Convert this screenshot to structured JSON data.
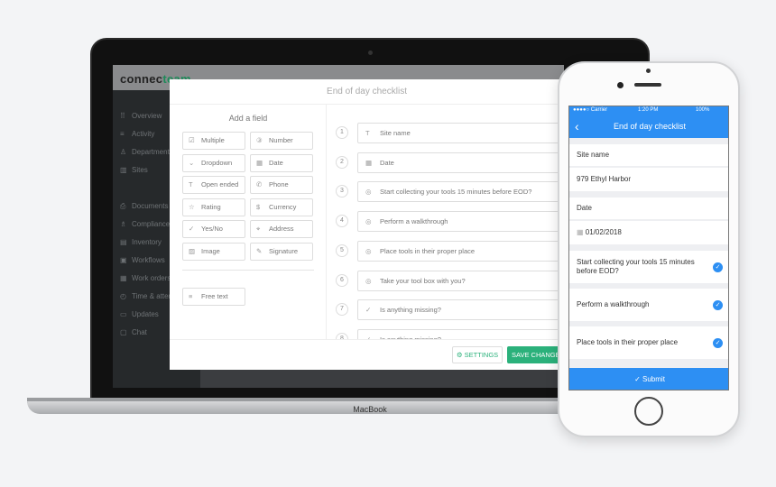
{
  "laptop": {
    "brand": "MacBook"
  },
  "app": {
    "logo_a": "connec",
    "logo_b": "team",
    "accent": "#2bb17b"
  },
  "sidebar": {
    "items": [
      {
        "icon": "grid-icon",
        "glyph": "⠿",
        "label": "Overview"
      },
      {
        "icon": "list-icon",
        "glyph": "≡",
        "label": "Activity"
      },
      {
        "icon": "user-icon",
        "glyph": "♙",
        "label": "Departments"
      },
      {
        "icon": "building-icon",
        "glyph": "▥",
        "label": "Sites"
      },
      {
        "icon": "document-icon",
        "glyph": "⎙",
        "label": "Documents"
      },
      {
        "icon": "compliance-icon",
        "glyph": "♗",
        "label": "Compliance"
      },
      {
        "icon": "inventory-icon",
        "glyph": "▤",
        "label": "Inventory"
      },
      {
        "icon": "workflow-icon",
        "glyph": "▣",
        "label": "Workflows"
      },
      {
        "icon": "work-order-icon",
        "glyph": "▦",
        "label": "Work orders"
      },
      {
        "icon": "clock-icon",
        "glyph": "◴",
        "label": "Time & attendance"
      },
      {
        "icon": "updates-icon",
        "glyph": "▭",
        "label": "Updates"
      },
      {
        "icon": "chat-icon",
        "glyph": "▢",
        "label": "Chat"
      }
    ]
  },
  "modal": {
    "title": "End of day checklist",
    "add_field_title": "Add a field",
    "fields": [
      {
        "icon": "checkbox-icon",
        "glyph": "☑",
        "label": "Multiple"
      },
      {
        "icon": "number-icon",
        "glyph": "③",
        "label": "Number"
      },
      {
        "icon": "chevron-down-icon",
        "glyph": "⌄",
        "label": "Dropdown"
      },
      {
        "icon": "calendar-icon",
        "glyph": "▦",
        "label": "Date"
      },
      {
        "icon": "text-icon",
        "glyph": "T",
        "label": "Open ended"
      },
      {
        "icon": "phone-icon",
        "glyph": "✆",
        "label": "Phone"
      },
      {
        "icon": "star-icon",
        "glyph": "☆",
        "label": "Rating"
      },
      {
        "icon": "currency-icon",
        "glyph": "$",
        "label": "Currency"
      },
      {
        "icon": "check-icon",
        "glyph": "✓",
        "label": "Yes/No"
      },
      {
        "icon": "location-icon",
        "glyph": "⌖",
        "label": "Address"
      },
      {
        "icon": "image-icon",
        "glyph": "▨",
        "label": "Image"
      },
      {
        "icon": "pen-icon",
        "glyph": "✎",
        "label": "Signature"
      }
    ],
    "free_text": {
      "icon": "paragraph-icon",
      "glyph": "≡",
      "label": "Free text"
    },
    "checklist": [
      {
        "n": "1",
        "icon": "text-icon",
        "glyph": "T",
        "label": "Site name"
      },
      {
        "n": "2",
        "icon": "calendar-icon",
        "glyph": "▦",
        "label": "Date"
      },
      {
        "n": "3",
        "icon": "check-circle-icon",
        "glyph": "◎",
        "label": "Start collecting your tools 15 minutes before EOD?"
      },
      {
        "n": "4",
        "icon": "check-circle-icon",
        "glyph": "◎",
        "label": "Perform a walkthrough"
      },
      {
        "n": "5",
        "icon": "check-circle-icon",
        "glyph": "◎",
        "label": "Place tools in their proper place"
      },
      {
        "n": "6",
        "icon": "check-circle-icon",
        "glyph": "◎",
        "label": "Take your tool box with you?"
      },
      {
        "n": "7",
        "icon": "check-icon",
        "glyph": "✓",
        "label": "Is anything missing?"
      },
      {
        "n": "8",
        "icon": "check-icon",
        "glyph": "✓",
        "label": "Is anything missing?"
      }
    ],
    "settings_label": "SETTINGS",
    "save_label": "SAVE CHANGES"
  },
  "phone": {
    "carrier": "●●●●○ Carrier",
    "time": "1:20 PM",
    "battery": "100%",
    "title": "End of day checklist",
    "accent": "#2d8ff3",
    "site_label": "Site name",
    "site_value": "979 Ethyl Harbor",
    "date_label": "Date",
    "date_value": "01/02/2018",
    "checks": [
      "Start collecting your tools 15 minutes before EOD?",
      "Perform a walkthrough",
      "Place tools in their proper place"
    ],
    "submit": "Submit"
  }
}
